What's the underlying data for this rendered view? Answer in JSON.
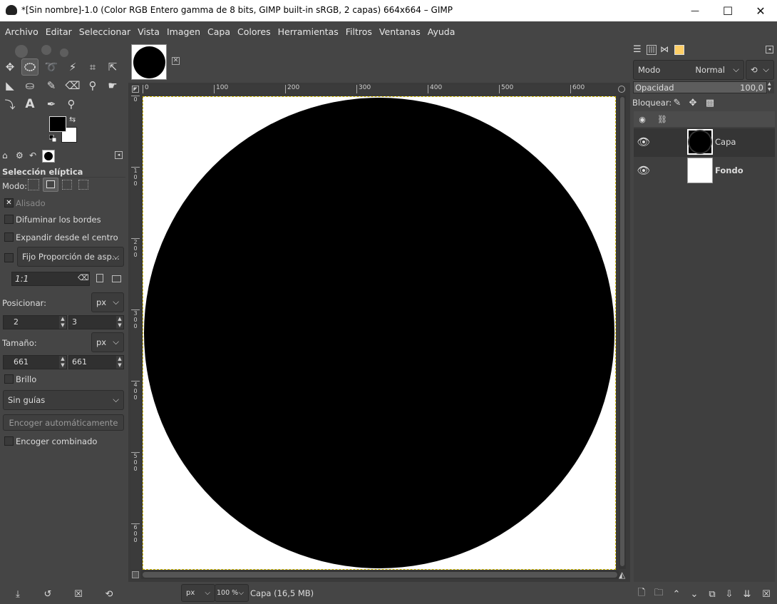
{
  "window": {
    "title": "*[Sin nombre]-1.0 (Color RGB Entero gamma de 8 bits, GIMP built-in sRGB, 2 capas) 664x664 – GIMP",
    "minimize": "—",
    "maximize": "☐",
    "close": "✕"
  },
  "menu": [
    "Archivo",
    "Editar",
    "Seleccionar",
    "Vista",
    "Imagen",
    "Capa",
    "Colores",
    "Herramientas",
    "Filtros",
    "Ventanas",
    "Ayuda"
  ],
  "tool_options": {
    "title": "Selección elíptica",
    "mode_label": "Modo:",
    "antialias": "Alisado",
    "feather": "Difuminar los bordes",
    "expand": "Expandir desde el centro",
    "fixed_combo": "Fijo Proporción de asp...",
    "ratio_value": "1:1",
    "position_label": "Posicionar:",
    "position_unit": "px",
    "pos_x": "2",
    "pos_y": "3",
    "size_label": "Tamaño:",
    "size_unit": "px",
    "size_w": "661",
    "size_h": "661",
    "highlight": "Brillo",
    "guides": "Sin guías",
    "autoshrink": "Encoger automáticamente",
    "shrink_merged": "Encoger combinado"
  },
  "rulers": {
    "h": [
      "0",
      "100",
      "200",
      "300",
      "400",
      "500",
      "600"
    ],
    "v": [
      "0",
      "1\n0\n0",
      "2\n0\n0",
      "3\n0\n0",
      "4\n0\n0",
      "5\n0\n0",
      "6\n0\n0"
    ]
  },
  "status": {
    "unit": "px",
    "zoom": "100 %",
    "info": "Capa (16,5 MB)"
  },
  "layers": {
    "mode_label": "Modo",
    "mode_value": "Normal",
    "opacity_label": "Opacidad",
    "opacity_value": "100,0",
    "lock_label": "Bloquear:",
    "items": [
      {
        "name": "Capa",
        "bold": false
      },
      {
        "name": "Fondo",
        "bold": true
      }
    ]
  },
  "colors": {
    "foreground": "#000000",
    "background": "#ffffff",
    "canvas_bg": "#3a3a3a",
    "ui_bg": "#454545"
  }
}
